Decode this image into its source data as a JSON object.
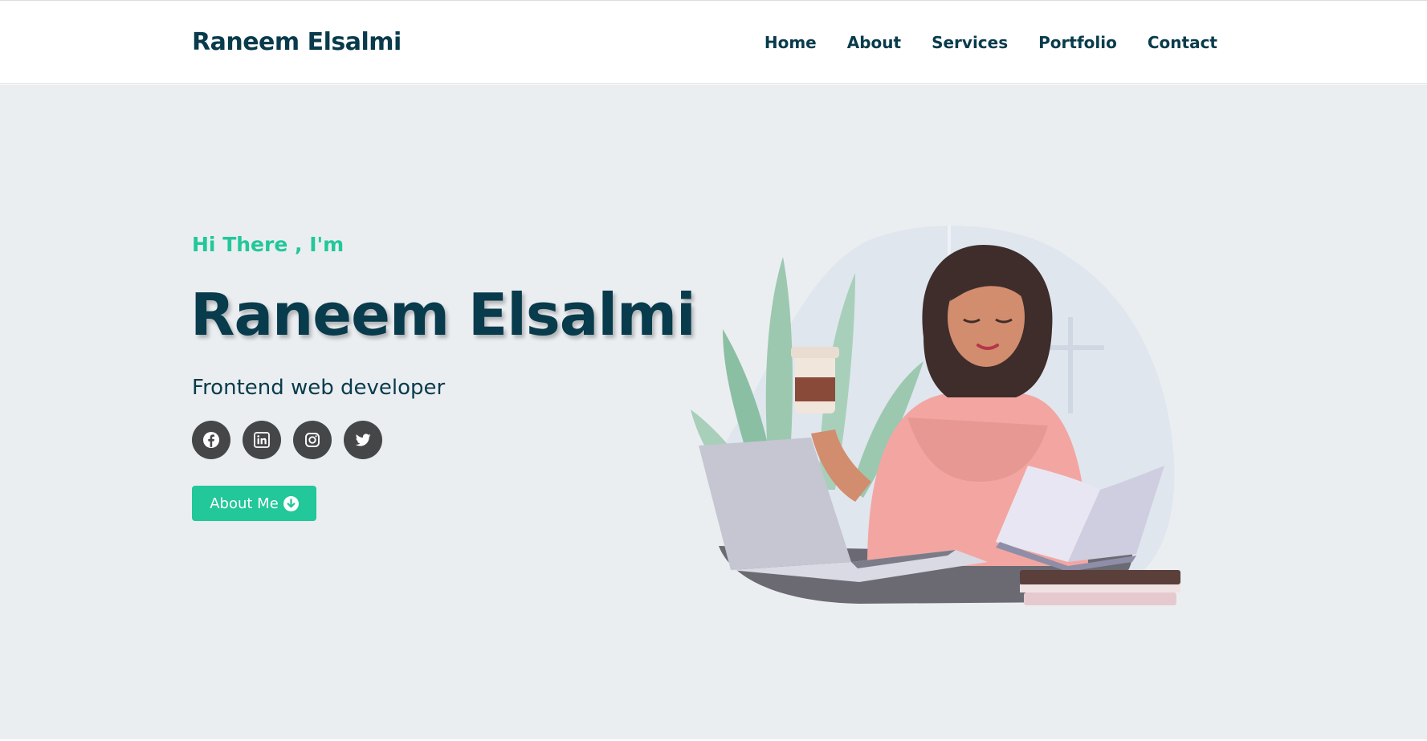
{
  "nav": {
    "brand": "Raneem Elsalmi",
    "links": [
      "Home",
      "About",
      "Services",
      "Portfolio",
      "Contact"
    ]
  },
  "hero": {
    "greeting": "Hi There , I'm",
    "name": "Raneem Elsalmi",
    "role": "Frontend web developer",
    "socials": [
      {
        "icon": "facebook-icon"
      },
      {
        "icon": "linkedin-icon"
      },
      {
        "icon": "instagram-icon"
      },
      {
        "icon": "twitter-icon"
      }
    ],
    "cta_label": "About Me",
    "cta_icon": "arrow-down-circle-icon"
  },
  "colors": {
    "accent": "#22c79a",
    "primary_text": "#083b4c",
    "hero_bg": "#ebeef1",
    "social_bg": "#444648"
  }
}
